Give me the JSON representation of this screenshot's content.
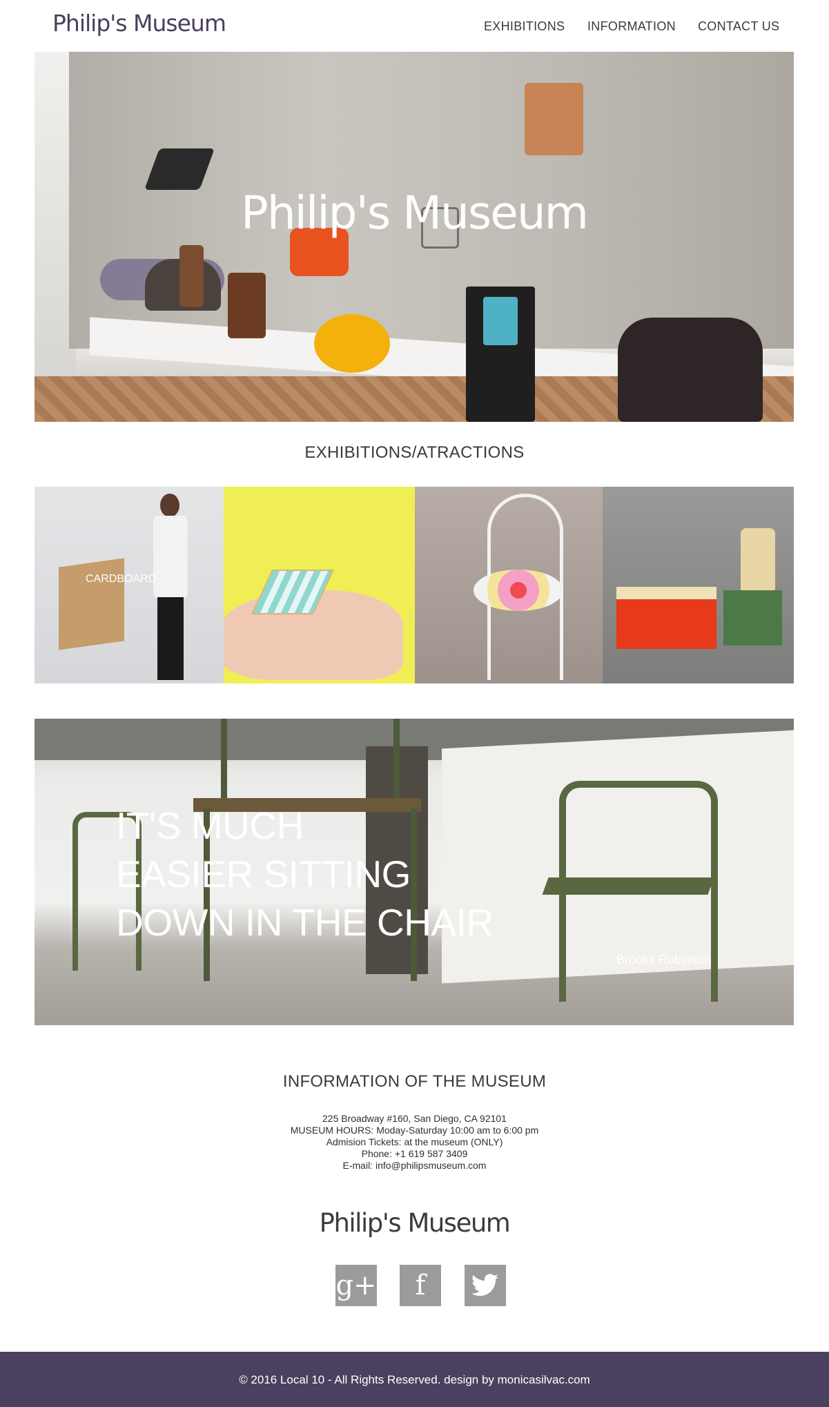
{
  "header": {
    "logo": "Philip's Museum",
    "nav": {
      "exhibitions": "EXHIBITIONS",
      "information": "INFORMATION",
      "contact": "CONTACT US"
    }
  },
  "hero": {
    "title": "Philip's Museum"
  },
  "exhibitions": {
    "title": "EXHIBITIONS/ATRACTIONS",
    "tiles": [
      {
        "label": "CARDBOARD"
      },
      {
        "label": ""
      },
      {
        "label": ""
      },
      {
        "label": ""
      }
    ]
  },
  "banner": {
    "quote_line1": "IT'S MUCH",
    "quote_line2": "EASIER SITTING",
    "quote_line3": "DOWN IN THE CHAIR",
    "author": "Brooks Robinson"
  },
  "info": {
    "title": "INFORMATION OF THE MUSEUM",
    "address": "225 Broadway #160, San Diego, CA 92101",
    "hours": "MUSEUM HOURS: Moday-Saturday 10:00 am to 6:00 pm",
    "tickets": "Admision Tickets: at the museum (ONLY)",
    "phone": "Phone: +1 619 587 3409",
    "email": "E-mail: info@philipsmuseum.com"
  },
  "footer": {
    "logo": "Philip's Museum",
    "social": {
      "google": "g+",
      "facebook": "f",
      "twitter": "🐦"
    },
    "copyright": "© 2016 Local 10 - All Rights Reserved. design by monicasilvac.com"
  },
  "colors": {
    "brand_purple": "#4c4060",
    "social_gray": "#9b9b9b"
  }
}
